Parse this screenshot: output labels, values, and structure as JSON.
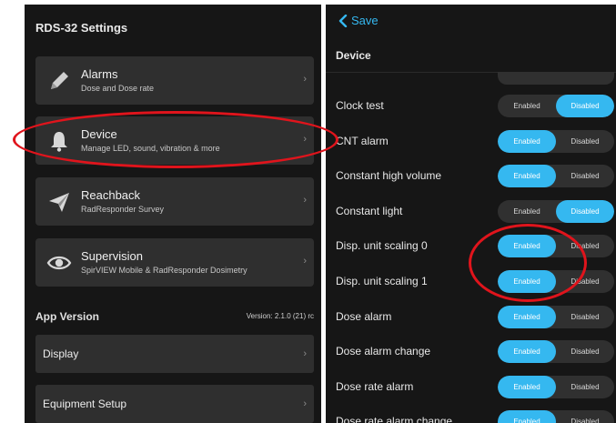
{
  "left_panel": {
    "title": "RDS-32 Settings",
    "menu": [
      {
        "title": "Alarms",
        "subtitle": "Dose and Dose rate",
        "icon": "pencil-icon"
      },
      {
        "title": "Device",
        "subtitle": "Manage LED, sound, vibration & more",
        "icon": "bell-icon"
      },
      {
        "title": "Reachback",
        "subtitle": "RadResponder Survey",
        "icon": "paper-plane-icon"
      },
      {
        "title": "Supervision",
        "subtitle": "SpirVIEW Mobile & RadResponder Dosimetry",
        "icon": "eye-icon"
      }
    ],
    "app_version_label": "App Version",
    "version_text": "Version: 2.1.0 (21) rc",
    "rows": [
      {
        "title": "Display"
      },
      {
        "title": "Equipment Setup"
      }
    ],
    "chevron": "›"
  },
  "right_panel": {
    "back_label": "Save",
    "title": "Device",
    "enabled_label": "Enabled",
    "disabled_label": "Disabled",
    "settings": [
      {
        "label": "Clock test",
        "state": "Disabled"
      },
      {
        "label": "CNT alarm",
        "state": "Enabled"
      },
      {
        "label": "Constant high volume",
        "state": "Enabled"
      },
      {
        "label": "Constant light",
        "state": "Disabled"
      },
      {
        "label": "Disp. unit scaling 0",
        "state": "Enabled"
      },
      {
        "label": "Disp. unit scaling 1",
        "state": "Enabled"
      },
      {
        "label": "Dose alarm",
        "state": "Enabled"
      },
      {
        "label": "Dose alarm change",
        "state": "Enabled"
      },
      {
        "label": "Dose rate alarm",
        "state": "Enabled"
      },
      {
        "label": "Dose rate alarm change",
        "state": "Enabled"
      }
    ]
  },
  "colors": {
    "accent": "#35b8f0",
    "panel_bg": "#161616",
    "card_bg": "#2f2f2f",
    "annotation_red": "#e0141c"
  }
}
